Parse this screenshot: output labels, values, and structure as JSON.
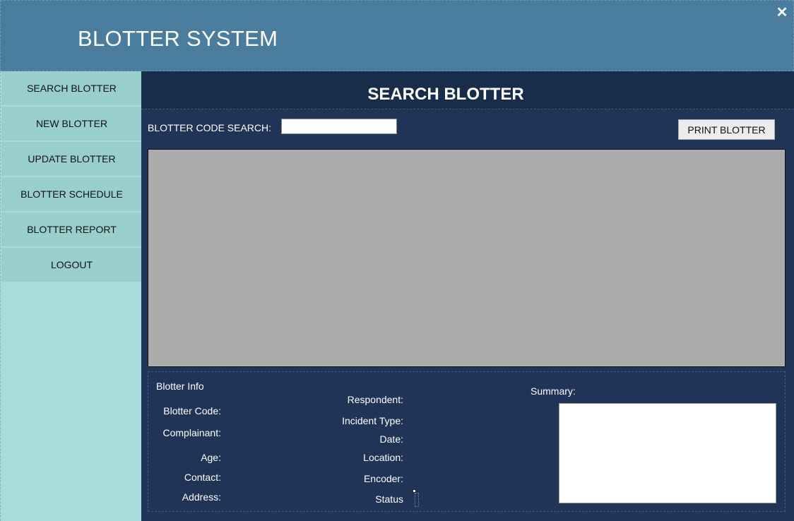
{
  "window": {
    "title": "BLOTTER SYSTEM",
    "close_label": "✕"
  },
  "sidebar": {
    "items": [
      {
        "label": "SEARCH BLOTTER"
      },
      {
        "label": "NEW BLOTTER"
      },
      {
        "label": "UPDATE BLOTTER"
      },
      {
        "label": "BLOTTER SCHEDULE"
      },
      {
        "label": "BLOTTER REPORT"
      },
      {
        "label": "LOGOUT"
      }
    ]
  },
  "main": {
    "section_title": "SEARCH BLOTTER",
    "search": {
      "label": "BLOTTER CODE SEARCH:",
      "value": "",
      "placeholder": ""
    },
    "print_button": "PRINT BLOTTER",
    "info": {
      "group_title": "Blotter Info",
      "blotter_code": "Blotter Code:",
      "complainant": "Complainant:",
      "age": "Age:",
      "contact": "Contact:",
      "address": "Address:",
      "respondent": "Respondent:",
      "incident_type": "Incident Type:",
      "date": "Date:",
      "location": "Location:",
      "encoder": "Encoder:",
      "status": "Status",
      "summary": "Summary:",
      "summary_value": ""
    }
  },
  "colors": {
    "header": "#4a7c9e",
    "sidebar": "#a6dcdb",
    "main_bg": "#1f3456",
    "grid": "#ababab"
  }
}
